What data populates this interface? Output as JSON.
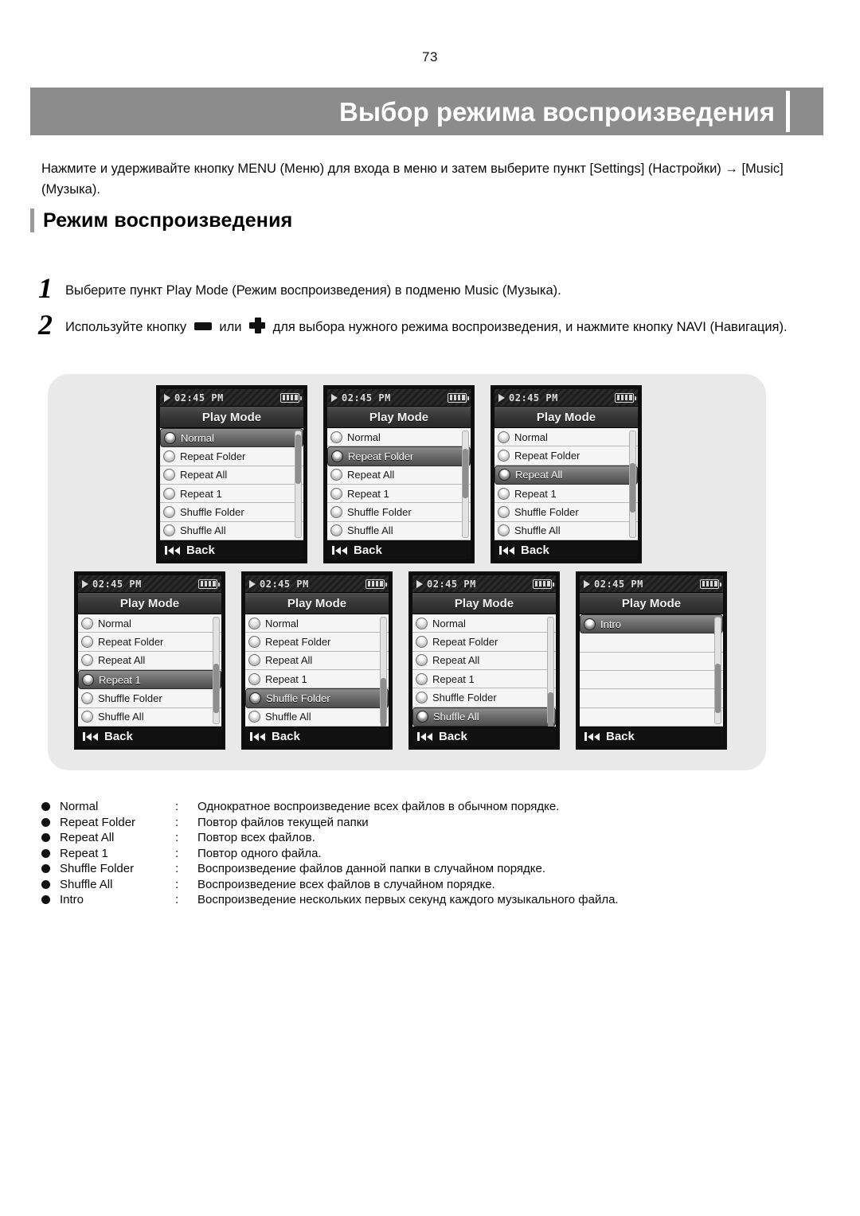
{
  "page_number": "73",
  "header": {
    "title": "Выбор режима воспроизведения"
  },
  "intro": "Нажмите и удерживайте кнопку MENU (Меню) для входа в меню и затем выберите пункт [Settings] (Настройки) → [Music] (Музыка).",
  "section": {
    "heading": "Режим воспроизведения"
  },
  "steps": [
    {
      "number": "1",
      "text": "Выберите пункт Play Mode (Режим воспроизведения) в подменю Music (Музыка)."
    },
    {
      "number": "2",
      "text_before": "Используйте кнопку",
      "or_word": "или",
      "text_after": "для выбора нужного режима воспроизведения, и нажмите кнопку NAVI (Навигация).",
      "icon_minus": "minus-button-icon",
      "icon_plus": "plus-button-icon"
    }
  ],
  "screens": {
    "status": {
      "clock": "02:45 PM",
      "play_icon": "play-icon",
      "battery_icon": "battery-full-icon",
      "battery_bars": 4
    },
    "title": "Play Mode",
    "footer": {
      "back_label": "Back",
      "prev_icon": "previous-track-icon"
    },
    "items": [
      "Normal",
      "Repeat Folder",
      "Repeat All",
      "Repeat 1",
      "Shuffle Folder",
      "Shuffle All"
    ],
    "last_screen_items": [
      "Intro",
      "",
      "",
      "",
      "",
      ""
    ],
    "shots": [
      {
        "selected_index": 0,
        "selected_label": "Normal"
      },
      {
        "selected_index": 1,
        "selected_label": "Repeat Folder"
      },
      {
        "selected_index": 2,
        "selected_label": "Repeat All"
      },
      {
        "selected_index": 3,
        "selected_label": "Repeat 1"
      },
      {
        "selected_index": 4,
        "selected_label": "Shuffle Folder"
      },
      {
        "selected_index": 5,
        "selected_label": "Shuffle All"
      },
      {
        "selected_index": 0,
        "selected_label": "Intro"
      }
    ]
  },
  "legend": {
    "separator": ":",
    "rows": [
      {
        "term": "Normal",
        "desc": "Однократное воспроизведение всех файлов в обычном порядке."
      },
      {
        "term": "Repeat Folder",
        "desc": "Повтор файлов текущей папки"
      },
      {
        "term": "Repeat All",
        "desc": "Повтор всех файлов."
      },
      {
        "term": "Repeat 1",
        "desc": "Повтор одного файла."
      },
      {
        "term": "Shuffle Folder",
        "desc": "Воспроизведение файлов данной папки в случайном порядке."
      },
      {
        "term": "Shuffle All",
        "desc": "Воспроизведение всех файлов в случайном порядке."
      },
      {
        "term": "Intro",
        "desc": "Воспроизведение нескольких первых секунд каждого музыкального файла."
      }
    ]
  },
  "colors": {
    "banner": "#8c8c8c",
    "panel": "#e9e9e9",
    "lcd_bezel": "#0d0d0d",
    "lcd_list": "#f2f2f2",
    "selected": "#6d6d6d"
  }
}
